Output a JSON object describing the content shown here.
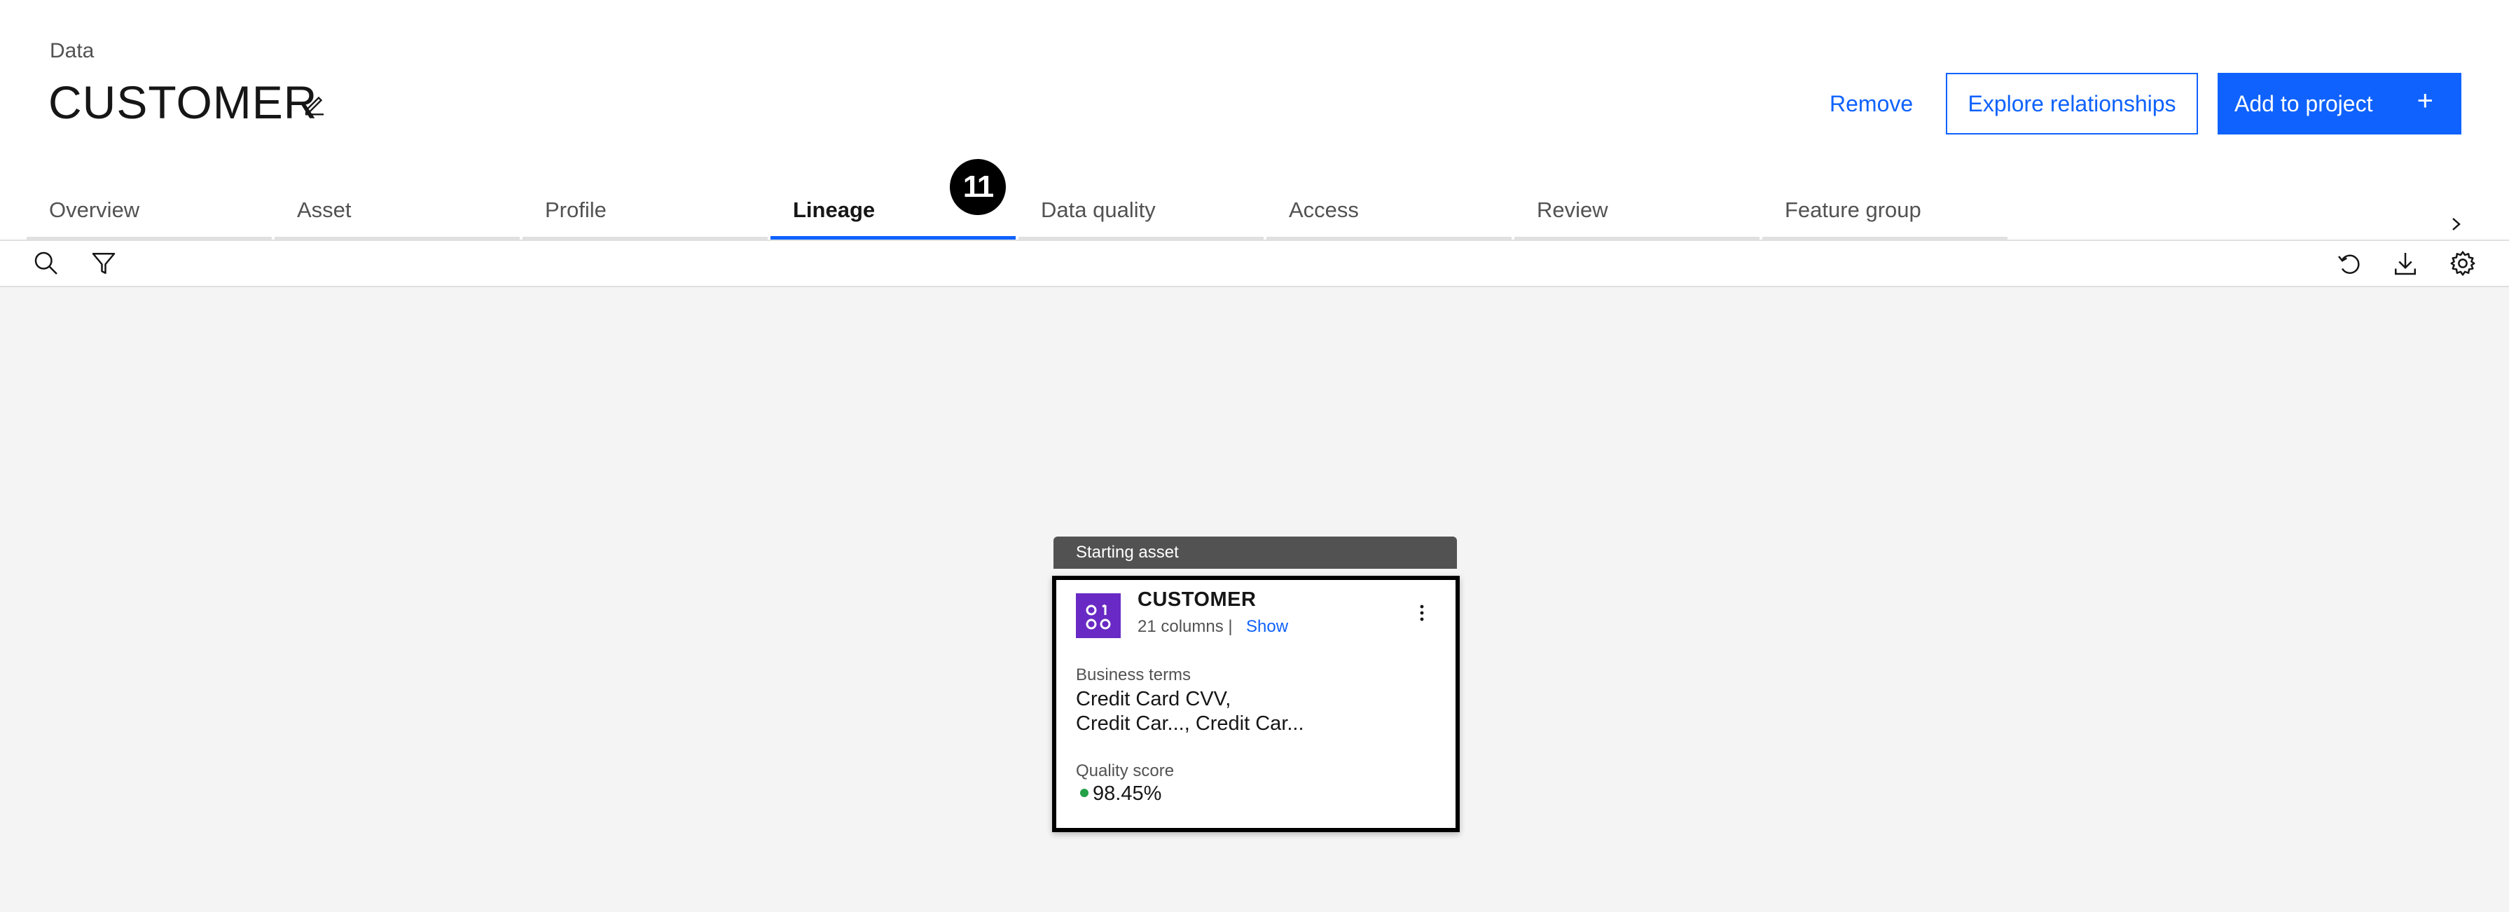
{
  "header": {
    "breadcrumb": "Data",
    "title": "CUSTOMER",
    "actions": {
      "remove": "Remove",
      "explore": "Explore relationships",
      "add": "Add to project",
      "add_icon": "+"
    }
  },
  "tabs": [
    {
      "label": "Overview"
    },
    {
      "label": "Asset"
    },
    {
      "label": "Profile"
    },
    {
      "label": "Lineage",
      "active": true
    },
    {
      "label": "Data quality"
    },
    {
      "label": "Access"
    },
    {
      "label": "Review"
    },
    {
      "label": "Feature group"
    }
  ],
  "annotation_badge": "11",
  "toolbar": {
    "icons": [
      "search-icon",
      "filter-icon",
      "reset-icon",
      "download-icon",
      "settings-icon"
    ]
  },
  "node": {
    "starting_label": "Starting asset",
    "title": "CUSTOMER",
    "columns_text": "21 columns |",
    "show_link": "Show",
    "business_terms_label": "Business terms",
    "business_terms_line1": "Credit Card CVV,",
    "business_terms_line2": "Credit Car..., Credit Car...",
    "quality_label": "Quality score",
    "quality_value": "98.45%"
  },
  "colors": {
    "primary": "#0f62fe",
    "node_icon": "#6929c4",
    "quality_dot": "#24a148",
    "canvas_bg": "#f4f4f4"
  }
}
